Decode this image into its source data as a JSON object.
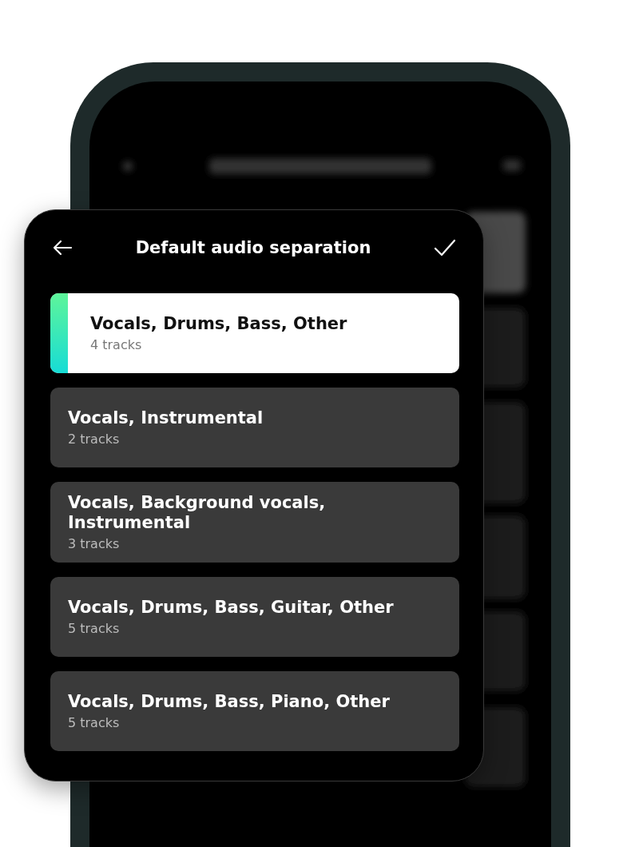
{
  "dialog": {
    "title": "Default audio separation"
  },
  "options": [
    {
      "title": "Vocals, Drums, Bass, Other",
      "subtitle": "4 tracks",
      "selected": true
    },
    {
      "title": "Vocals, Instrumental",
      "subtitle": "2 tracks",
      "selected": false
    },
    {
      "title": "Vocals, Background vocals, Instrumental",
      "subtitle": "3 tracks",
      "selected": false
    },
    {
      "title": "Vocals, Drums, Bass, Guitar, Other",
      "subtitle": "5 tracks",
      "selected": false
    },
    {
      "title": "Vocals, Drums, Bass, Piano, Other",
      "subtitle": "5 tracks",
      "selected": false
    }
  ]
}
